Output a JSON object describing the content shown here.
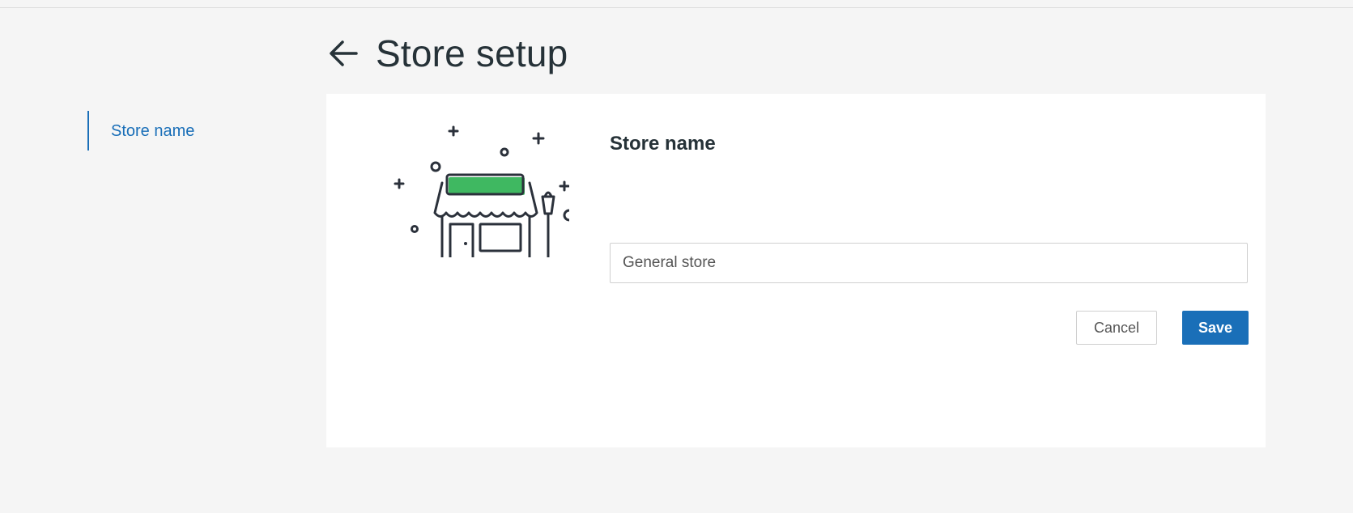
{
  "page": {
    "title": "Store setup"
  },
  "side_nav": {
    "items": [
      {
        "label": "Store name",
        "active": true
      }
    ]
  },
  "store_name_section": {
    "title": "Store name",
    "input_value": "General store",
    "cancel_label": "Cancel",
    "save_label": "Save"
  },
  "icons": {
    "back": "arrow-left-icon",
    "illustration": "storefront-illustration"
  },
  "colors": {
    "accent": "#1a6fb8",
    "awning_sign": "#3fb861",
    "text_dark": "#263238",
    "background": "#f5f5f5"
  }
}
